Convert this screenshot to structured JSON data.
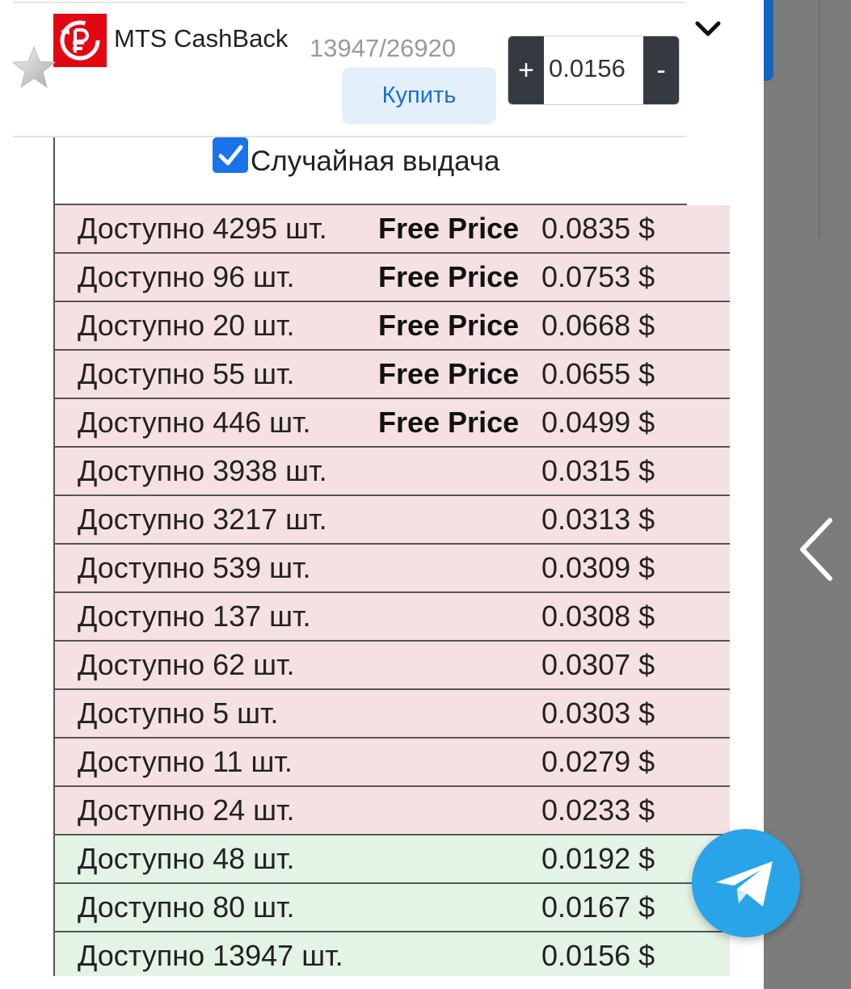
{
  "product": {
    "title": "MTS CashBack",
    "stock": "13947/26920",
    "buy_label": "Купить",
    "logo_icon": "ruble-refresh-icon",
    "logo_color": "#e30613",
    "favorite_icon": "star-icon"
  },
  "stepper": {
    "plus_label": "+",
    "value": "0.0156",
    "minus_label": "-"
  },
  "random": {
    "label": "Случайная выдача",
    "checked": true
  },
  "offers": [
    {
      "available": "Доступно 4295 шт.",
      "free": "Free Price",
      "price": "0.0835 $",
      "status": "pink"
    },
    {
      "available": "Доступно 96 шт.",
      "free": "Free Price",
      "price": "0.0753 $",
      "status": "pink"
    },
    {
      "available": "Доступно 20 шт.",
      "free": "Free Price",
      "price": "0.0668 $",
      "status": "pink"
    },
    {
      "available": "Доступно 55 шт.",
      "free": "Free Price",
      "price": "0.0655 $",
      "status": "pink"
    },
    {
      "available": "Доступно 446 шт.",
      "free": "Free Price",
      "price": "0.0499 $",
      "status": "pink"
    },
    {
      "available": "Доступно 3938 шт.",
      "free": "",
      "price": "0.0315 $",
      "status": "pink"
    },
    {
      "available": "Доступно 3217 шт.",
      "free": "",
      "price": "0.0313 $",
      "status": "pink"
    },
    {
      "available": "Доступно 539 шт.",
      "free": "",
      "price": "0.0309 $",
      "status": "pink"
    },
    {
      "available": "Доступно 137 шт.",
      "free": "",
      "price": "0.0308 $",
      "status": "pink"
    },
    {
      "available": "Доступно 62 шт.",
      "free": "",
      "price": "0.0307 $",
      "status": "pink"
    },
    {
      "available": "Доступно 5 шт.",
      "free": "",
      "price": "0.0303 $",
      "status": "pink"
    },
    {
      "available": "Доступно 11 шт.",
      "free": "",
      "price": "0.0279 $",
      "status": "pink"
    },
    {
      "available": "Доступно 24 шт.",
      "free": "",
      "price": "0.0233 $",
      "status": "pink"
    },
    {
      "available": "Доступно 48 шт.",
      "free": "",
      "price": "0.0192 $",
      "status": "green"
    },
    {
      "available": "Доступно 80 шт.",
      "free": "",
      "price": "0.0167 $",
      "status": "green"
    },
    {
      "available": "Доступно 13947 шт.",
      "free": "",
      "price": "0.0156 $",
      "status": "green"
    }
  ],
  "colors": {
    "pink_row": "#f5e1e1",
    "green_row": "#e3f3e6",
    "accent": "#1a73e8",
    "telegram": "#2aa4e8"
  },
  "floating": {
    "telegram_icon": "telegram-plane-icon",
    "back_icon": "chevron-left-icon",
    "collapse_icon": "chevron-down-icon"
  }
}
